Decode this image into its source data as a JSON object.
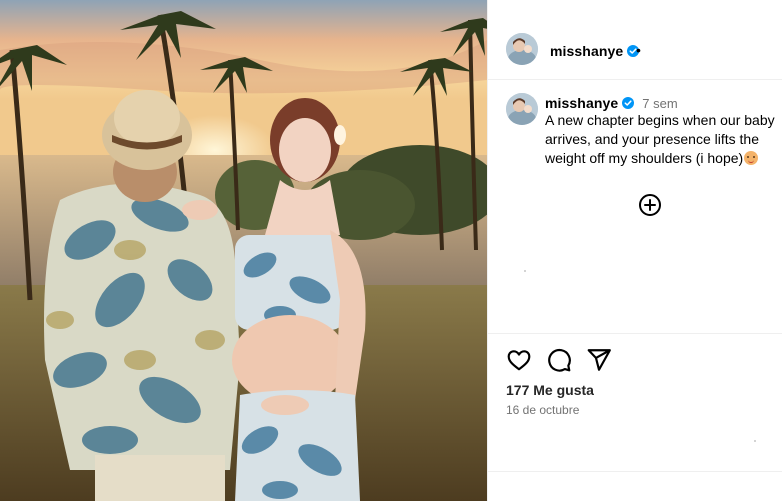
{
  "post": {
    "username": "misshanye",
    "time_ago": "7 sem",
    "caption": "A new chapter begins when our baby arrives, and your presence lifts the weight off my shoulders (i hope)",
    "caption_emoji": "smiling-face-emoji",
    "likes": "177 Me gusta",
    "date": "16 de octubre",
    "header_separator": "•"
  },
  "icons": {
    "verified": "verified-badge-icon",
    "add_comment": "plus-circle-icon",
    "like": "heart-icon",
    "comment": "speech-bubble-icon",
    "share": "paper-plane-icon"
  },
  "colors": {
    "verified_blue": "#0095f6",
    "muted_text": "#737373",
    "divider": "#efefef"
  }
}
